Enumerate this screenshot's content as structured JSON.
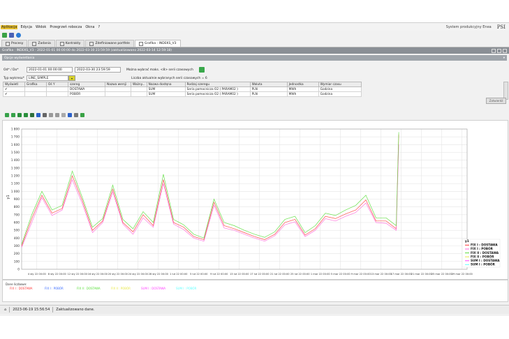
{
  "menu": {
    "items": [
      "Aplikacja",
      "Edycja",
      "Widok",
      "Przegrzeń robocza",
      "Okna",
      "?"
    ],
    "system_name": "System produkcyjny Enea",
    "logo": "PSI"
  },
  "tabs": [
    {
      "label": "Procesy"
    },
    {
      "label": "Zadania"
    },
    {
      "label": "Kontrakty"
    },
    {
      "label": "Zdefiniowane portfele"
    },
    {
      "label": "Grafika : INDEKS_V3"
    }
  ],
  "window_title": "Grafika : INDEKS_V3 - 2022-01-01 00:00:00 do 2022-03-30 23:59:59 (zaktualizowano 2022-03-14 12:59:18)",
  "panel_title": "Opcje wyświetlania",
  "params": {
    "od_label": "Od* / Do*",
    "from": "2022-01-01 00:00:00",
    "to": "2022-03-30 23:59:59",
    "max_label": "Można wybrać maks. <8> serii czasowych",
    "typ_label": "Typ wykresu*",
    "typ_value": "LINE_SIMPLE",
    "count_label": "Liczba aktualnie wybranych serii czasowych = 6"
  },
  "table": {
    "headers": [
      "Wyświetl",
      "Grafika",
      "Oś Y",
      "szereg",
      "Nazwa wersji",
      "Ważny...",
      "Nazwa dostęna",
      "Rodzaj szeregu",
      "Waluta",
      "Jednostka",
      "Wymiar czasu"
    ],
    "rows": [
      [
        "✔",
        "",
        "",
        "DOSTAWA",
        "",
        "",
        "SUM",
        "Seria pomocnicza O2 ( PARAM02 )",
        "PLN",
        "MWh",
        "Godzina"
      ],
      [
        "✔",
        "",
        "",
        "POBÓR",
        "",
        "",
        "SUM",
        "Seria pomocnicza O2 ( PARAM02 )",
        "PLN",
        "MWh",
        "Godzina"
      ]
    ]
  },
  "pokaz_label": "Zatwierdź",
  "legend_caption": "Dane liczbowe:",
  "status": {
    "timestamp": "2023-06-19 15:56:54",
    "message": "Zaktualizowano dane."
  },
  "chart_data": {
    "type": "line",
    "ylabel": "y1",
    "ylim": [
      0,
      1800
    ],
    "yticks": [
      0,
      100,
      200,
      300,
      400,
      500,
      600,
      700,
      800,
      900,
      1000,
      1100,
      1200,
      1300,
      1400,
      1500,
      1600,
      1700,
      1800
    ],
    "ytick_labels": [
      "0",
      "100",
      "200",
      "300",
      "400",
      "500",
      "600",
      "700",
      "800",
      "900",
      "1 000",
      "1 100",
      "1 200",
      "1 300",
      "1 400",
      "1 500",
      "1 600",
      "1 700",
      "1 800"
    ],
    "xlim": [
      0,
      88
    ],
    "x_tick_labels": [
      "4 sty 22 00:00",
      "8 sty 22 00:00",
      "12 sty 22 00:00",
      "16 sty 22 00:00",
      "20 sty 22 00:00",
      "24 sty 22 00:00",
      "28 sty 22 00:00",
      "1 lut 22 00:00",
      "5 lut 22 00:00",
      "9 lut 22 00:00",
      "13 lut 22 00:00",
      "17 lut 22 00:00",
      "21 lut 22 00:00",
      "25 lut 22 00:00",
      "1 mar 22 00:00",
      "5 mar 22 00:00",
      "9 mar 22 00:00",
      "13 mar 22 00:00",
      "17 mar 22 00:00",
      "21 mar 22 00:00",
      "25 mar 22 00:00",
      "29 mar 22 00:00"
    ],
    "x_tick_days": [
      3,
      7,
      11,
      15,
      19,
      23,
      27,
      31,
      35,
      39,
      43,
      47,
      51,
      55,
      59,
      63,
      67,
      71,
      75,
      79,
      83,
      87
    ],
    "days": [
      0,
      2,
      4,
      6,
      8,
      10,
      12,
      14,
      16,
      18,
      20,
      22,
      24,
      26,
      28,
      30,
      32,
      34,
      36,
      38,
      40,
      42,
      44,
      46,
      48,
      50,
      52,
      54,
      56,
      58,
      60,
      62,
      64,
      66,
      68,
      70,
      72,
      74,
      74.5
    ],
    "series": [
      {
        "name": "FIX I : DOSTAWA",
        "color": "#ff3b3b",
        "values": [
          300,
          650,
          950,
          720,
          780,
          1200,
          880,
          500,
          620,
          1030,
          600,
          480,
          700,
          560,
          1150,
          600,
          540,
          420,
          380,
          860,
          560,
          520,
          470,
          420,
          380,
          450,
          600,
          640,
          440,
          520,
          680,
          650,
          710,
          760,
          890,
          620,
          620,
          520,
          1730
        ]
      },
      {
        "name": "FIX I : POBÓR",
        "color": "#ff66d9",
        "values": [
          280,
          600,
          920,
          690,
          760,
          1150,
          840,
          470,
          600,
          990,
          580,
          450,
          660,
          540,
          1100,
          580,
          510,
          400,
          360,
          820,
          530,
          500,
          450,
          400,
          360,
          430,
          570,
          610,
          420,
          500,
          650,
          620,
          680,
          730,
          850,
          600,
          590,
          500,
          1600
        ]
      },
      {
        "name": "FIX II : DOSTAWA",
        "color": "#5adf3b",
        "values": [
          320,
          700,
          1000,
          760,
          820,
          1260,
          920,
          540,
          650,
          1080,
          640,
          520,
          740,
          600,
          1220,
          640,
          570,
          450,
          400,
          900,
          600,
          560,
          500,
          450,
          410,
          480,
          640,
          680,
          470,
          560,
          720,
          690,
          760,
          820,
          950,
          660,
          660,
          560,
          1760
        ]
      }
    ],
    "legend": [
      "y1",
      "FIX I : DOSTAWA",
      "FIX I : POBÓR",
      "FIX II : DOSTAWA",
      "FIX II : POBÓR",
      "SUM I : DOSTAWA",
      "SUM I : POBÓR"
    ],
    "legend_colors": [
      "#000000",
      "#ff3b3b",
      "#ff66d9",
      "#5adf3b",
      "#e8e84a",
      "#ff44ff",
      "#66ffff"
    ]
  },
  "colors": {
    "menu_active": "#e9c12e",
    "title_bar": "#8a8f95",
    "grid": "#e4e4e4"
  }
}
